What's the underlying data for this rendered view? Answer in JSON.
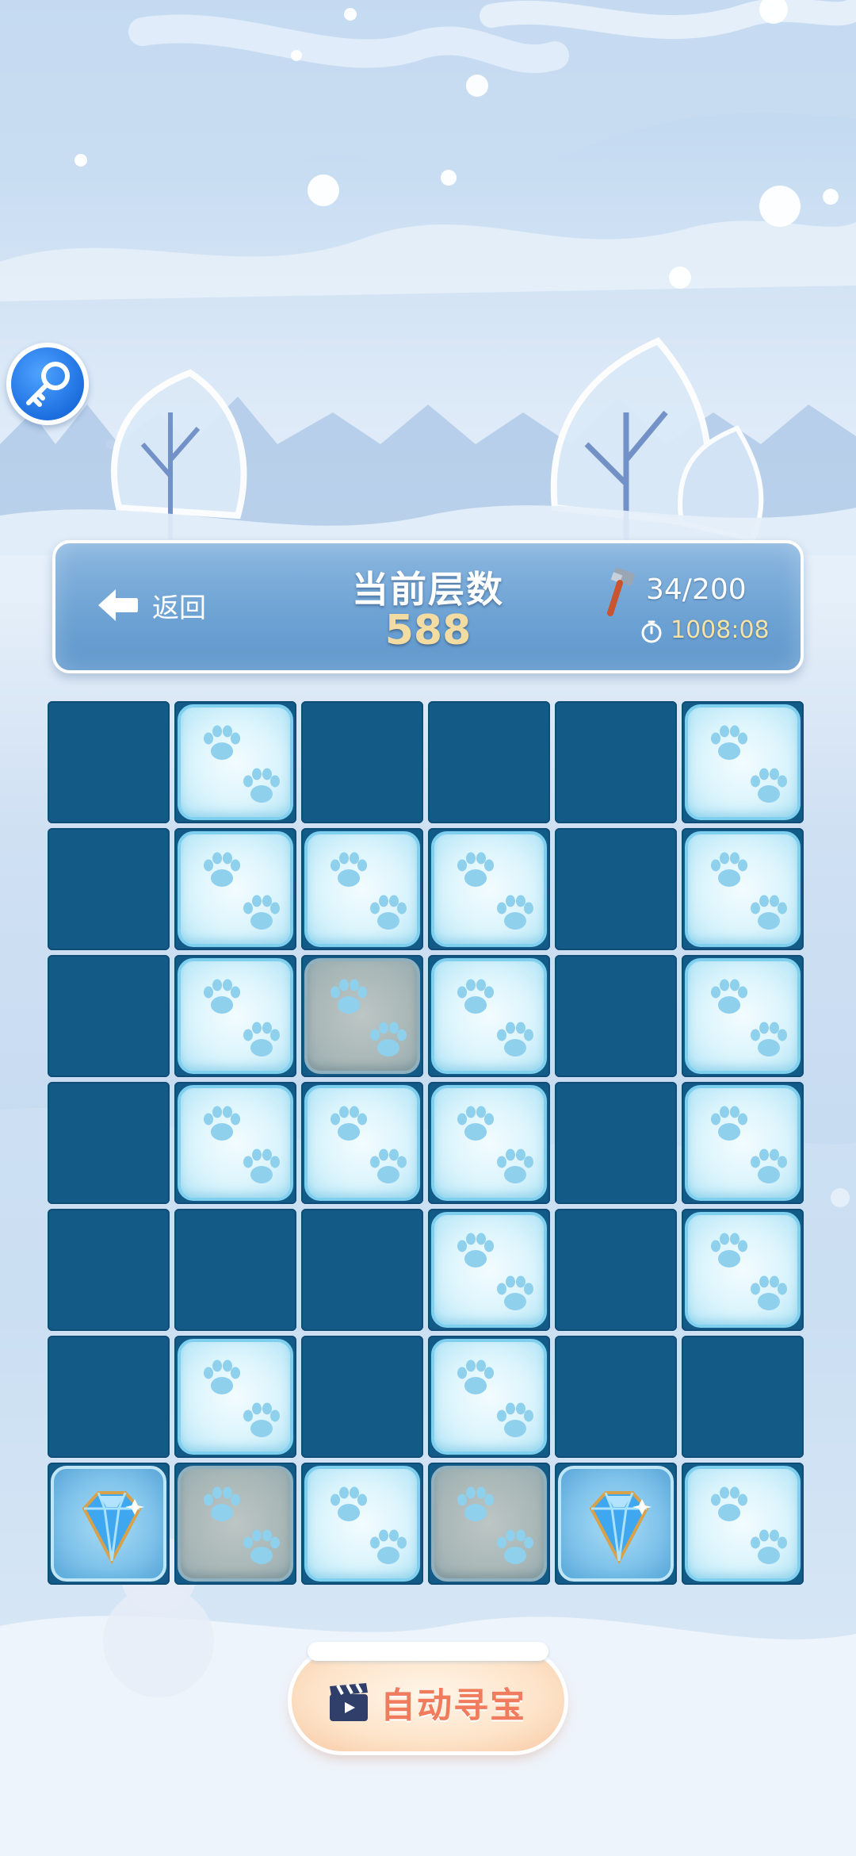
{
  "header": {
    "back_label": "返回",
    "layer_title": "当前层数",
    "layer_value": "588",
    "hammer_count": "34/200",
    "timer": "1008:08"
  },
  "board": {
    "rows": [
      [
        "empty",
        "paw",
        "empty",
        "empty",
        "empty",
        "paw"
      ],
      [
        "empty",
        "paw",
        "paw",
        "paw",
        "empty",
        "paw"
      ],
      [
        "empty",
        "paw",
        "paw-dim",
        "paw",
        "empty",
        "paw"
      ],
      [
        "empty",
        "paw",
        "paw",
        "paw",
        "empty",
        "paw"
      ],
      [
        "empty",
        "empty",
        "empty",
        "paw",
        "empty",
        "paw"
      ],
      [
        "empty",
        "paw",
        "empty",
        "paw",
        "empty",
        "empty"
      ],
      [
        "gem",
        "paw-dim",
        "paw",
        "paw-dim",
        "gem",
        "paw"
      ]
    ]
  },
  "auto_button": {
    "label": "自动寻宝"
  },
  "icons": {
    "key": "key-icon",
    "back": "back-arrow-icon",
    "hammer": "hammer-icon",
    "timer": "stopwatch-icon",
    "paw": "paw-print-icon",
    "gem": "diamond-icon",
    "clapper": "clapperboard-icon"
  },
  "colors": {
    "cell_empty": "#145a87",
    "tile_border": "#7fd0ef",
    "layer_value": "#f3dca2",
    "timer": "#f6e2a4",
    "auto_label": "#f07c5d",
    "key_button": "#1d6fe0"
  }
}
